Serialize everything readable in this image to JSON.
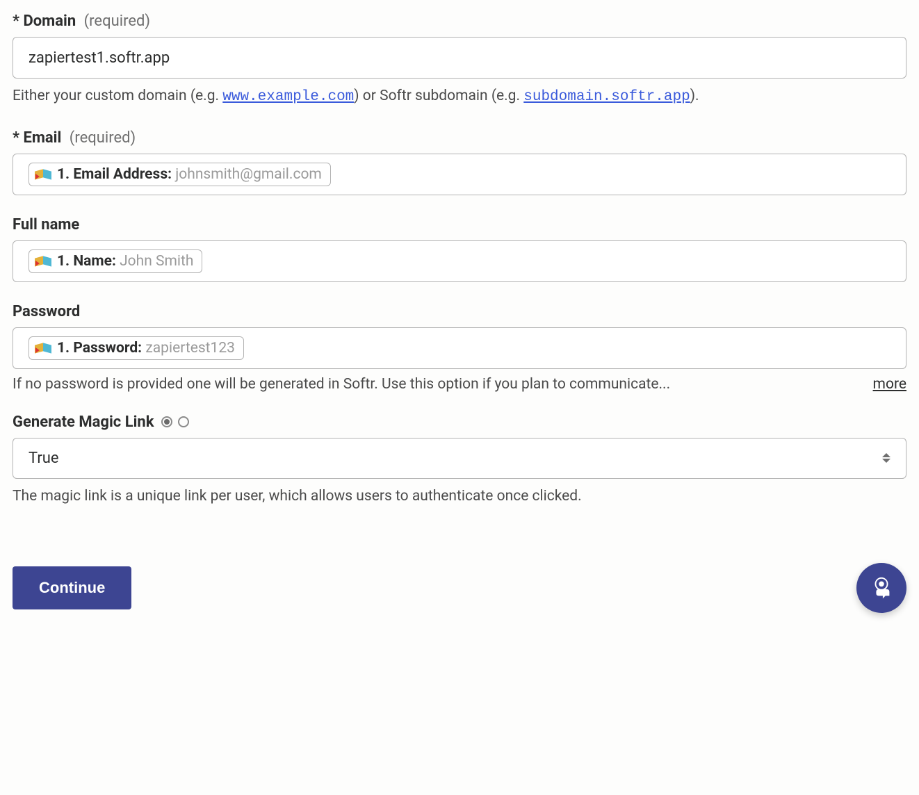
{
  "fields": {
    "domain": {
      "asterisk": "*",
      "label": "Domain",
      "required": "(required)",
      "value": "zapiertest1.softr.app",
      "help_prefix": "Either your custom domain (e.g. ",
      "help_link1": "www.example.com",
      "help_mid": ") or Softr subdomain (e.g. ",
      "help_link2": "subdomain.softr.app",
      "help_suffix": ")."
    },
    "email": {
      "asterisk": "*",
      "label": "Email",
      "required": "(required)",
      "pill_label": "1. Email Address: ",
      "pill_value": "johnsmith@gmail.com"
    },
    "fullname": {
      "label": "Full name",
      "pill_label": "1. Name: ",
      "pill_value": "John Smith"
    },
    "password": {
      "label": "Password",
      "pill_label": "1. Password: ",
      "pill_value": "zapiertest123",
      "help_text": "If no password is provided one will be generated in Softr. Use this option if you plan to communicate...",
      "more": "more"
    },
    "magic": {
      "label": "Generate Magic Link",
      "selected": "True",
      "help_text": "The magic link is a unique link per user, which allows users to authenticate once clicked."
    }
  },
  "footer": {
    "continue": "Continue"
  }
}
